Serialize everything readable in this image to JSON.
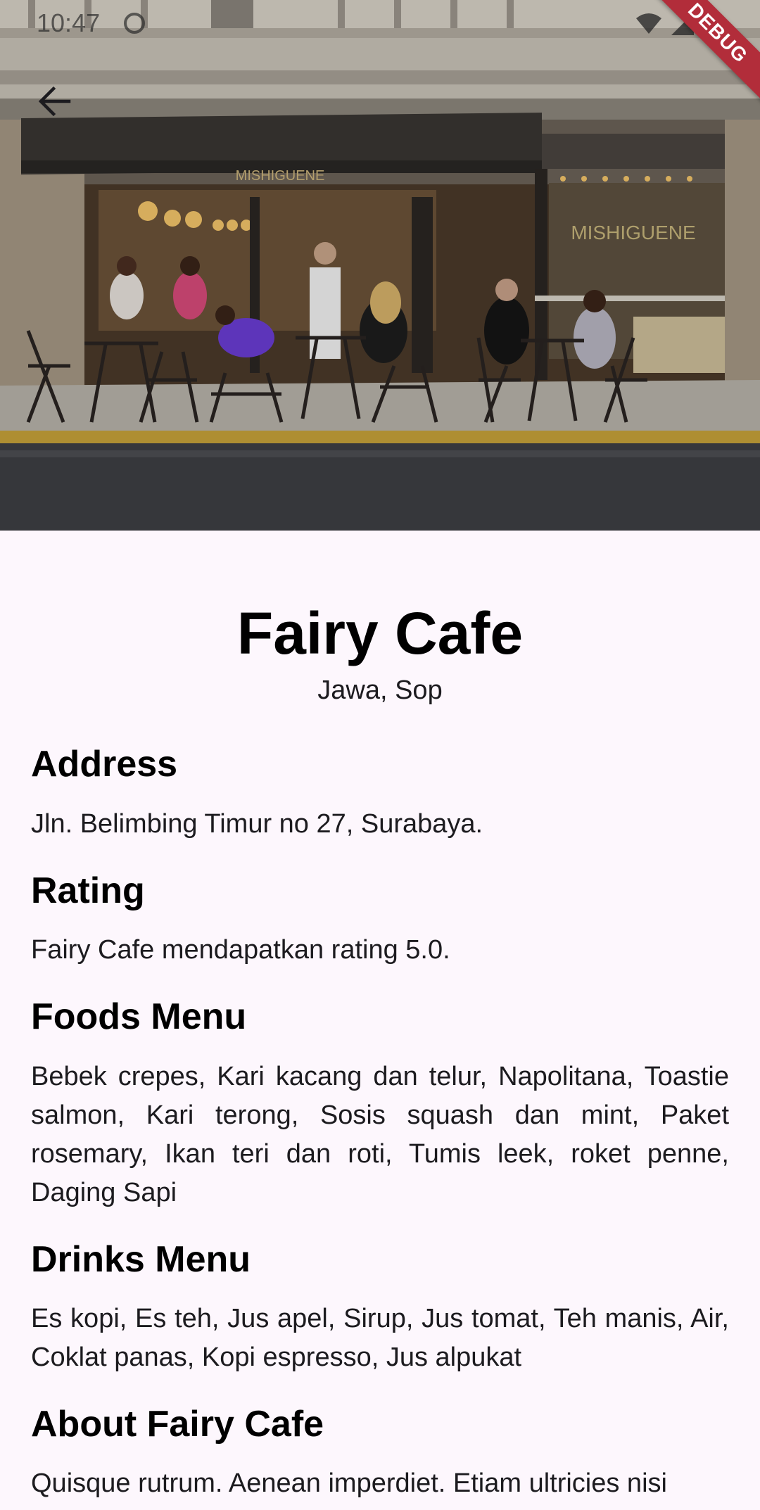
{
  "status_bar": {
    "time": "10:47",
    "icons": [
      "alarm-icon",
      "wifi-icon",
      "signal-icon",
      "battery-icon"
    ]
  },
  "debug_banner": "DEBUG",
  "hero": {
    "storefront_sign": "MISHIGUENE",
    "window_sign": "MISHIGUENE"
  },
  "cafe": {
    "name": "Fairy Cafe",
    "categories": "Jawa, Sop"
  },
  "sections": {
    "address": {
      "heading": "Address",
      "body": "Jln. Belimbing Timur no 27, Surabaya."
    },
    "rating": {
      "heading": "Rating",
      "body": "Fairy Cafe mendapatkan rating 5.0."
    },
    "foods": {
      "heading": "Foods Menu",
      "body": "Bebek crepes, Kari kacang dan telur, Napolitana, Toastie salmon, Kari terong, Sosis squash dan mint, Paket rosemary, Ikan teri dan roti, Tumis leek, roket penne, Daging Sapi"
    },
    "drinks": {
      "heading": "Drinks Menu",
      "body": "Es kopi, Es teh, Jus apel, Sirup, Jus tomat, Teh manis, Air, Coklat panas, Kopi espresso, Jus alpukat"
    },
    "about": {
      "heading": "About Fairy Cafe",
      "body": "Quisque rutrum. Aenean imperdiet. Etiam ultricies nisi"
    }
  },
  "colors": {
    "background": "#fdf7fd",
    "debug_banner": "#b22d3a",
    "text": "#1c1b1f"
  }
}
